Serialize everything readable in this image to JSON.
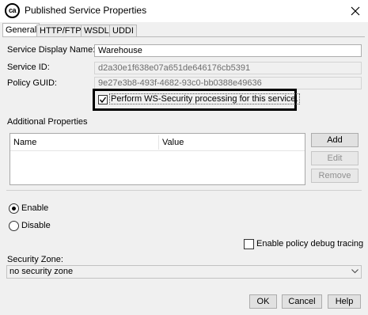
{
  "window": {
    "logo_text": "ca",
    "title": "Published Service Properties",
    "close_icon": "close-icon"
  },
  "tabs": [
    {
      "label": "General",
      "active": true
    },
    {
      "label": "HTTP/FTP",
      "active": false
    },
    {
      "label": "WSDL",
      "active": false
    },
    {
      "label": "UDDI",
      "active": false
    }
  ],
  "general": {
    "display_name_label": "Service Display Name:",
    "display_name_value": "Warehouse",
    "service_id_label": "Service ID:",
    "service_id_value": "d2a30e1f638e07a651de646176cb5391",
    "policy_guid_label": "Policy GUID:",
    "policy_guid_value": "9e27e3b8-493f-4682-93c0-bb0388e49636",
    "ws_security_label": "Perform WS-Security processing for this service.",
    "ws_security_checked": true
  },
  "additional_properties": {
    "title": "Additional Properties",
    "columns": [
      "Name",
      "Value"
    ],
    "rows": [],
    "buttons": {
      "add": "Add",
      "edit": "Edit",
      "remove": "Remove"
    }
  },
  "status": {
    "enable_label": "Enable",
    "disable_label": "Disable",
    "selected": "Enable"
  },
  "debug": {
    "label": "Enable policy debug tracing",
    "checked": false
  },
  "security_zone": {
    "label": "Security Zone:",
    "selected": "no security zone"
  },
  "footer": {
    "ok": "OK",
    "cancel": "Cancel",
    "help": "Help"
  },
  "colors": {
    "dialog_bg": "#f0f0f0",
    "button_bg": "#e1e1e1",
    "highlight_border": "#000000"
  }
}
